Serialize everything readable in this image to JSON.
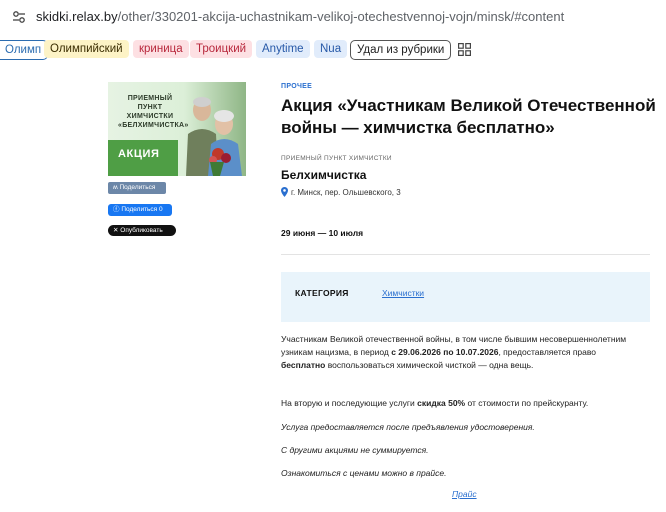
{
  "browser": {
    "url_host": "skidki.relax.by",
    "url_path": "/other/330201-akcija-uchastnikam-velikoj-otechestvennoj-vojn/minsk/#content"
  },
  "tags": [
    "Олимп",
    "Олимпийский",
    "криница",
    "Троицкий",
    "Anytime",
    "Nua",
    "Удал из рубрики"
  ],
  "promo": {
    "image_text": "ПРИЕМНЫЙ ПУНКТ ХИМЧИСТКИ «БЕЛХИМЧИСТКА»",
    "badge": "АКЦИЯ"
  },
  "share": {
    "vk": "Поделиться",
    "fb": "Поделиться 0",
    "x": "Опубликовать"
  },
  "article": {
    "category_kicker": "ПРОЧЕЕ",
    "title": "Акция «Участникам Великой Отечественной войны — химчистка бесплатно»",
    "org_kicker": "ПРИЕМНЫЙ ПУНКТ ХИМЧИСТКИ",
    "org_name": "Белхимчистка",
    "address": "г. Минск, пер. Ольшевского, 3",
    "dates": "29 июня — 10 июля",
    "category_box_label": "КАТЕГОРИЯ",
    "category_box_link": "Химчистки",
    "p1_a": "Участникам Великой отечественной войны, в том числе бывшим несовершеннолетним узникам нацизма, в период ",
    "p1_b": "с 29.06.2026 по 10.07.2026",
    "p1_c": ", предоставляется право ",
    "p1_d": "бесплатно",
    "p1_e": " воспользоваться химической чисткой — одна вещь.",
    "p2_a": "На вторую и последующие услуги ",
    "p2_b": "скидка 50%",
    "p2_c": " от стоимости по прейскуранту.",
    "p3": "Услуга предоставляется после предъявления удостоверения.",
    "p4": "С другими акциями не суммируется.",
    "p5": "Ознакомиться с ценами можно в прайсе.",
    "price_link": "Прайс"
  },
  "colors": {
    "accent_blue": "#2a6fcf",
    "category_bg": "#e9f4fb",
    "promo_green": "#4f9e45"
  }
}
